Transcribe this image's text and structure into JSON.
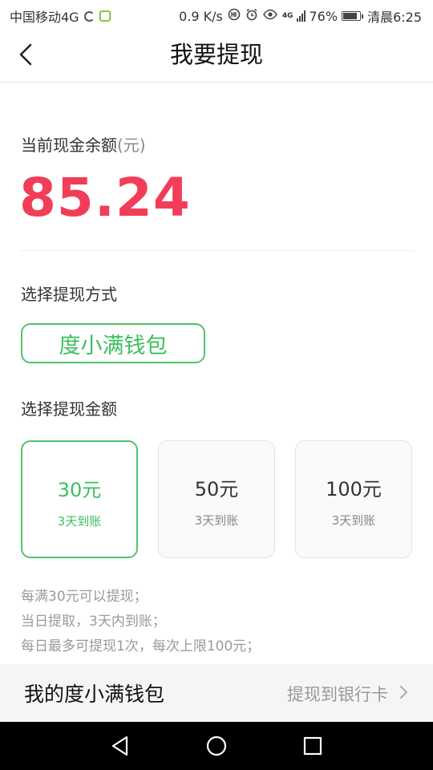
{
  "status_bar": {
    "carrier": "中国移动4G",
    "speed": "0.9 K/s",
    "battery": "76%",
    "time": "清晨6:25",
    "net_tag": "4G"
  },
  "header": {
    "title": "我要提现",
    "back_icon": "chevron-left-icon"
  },
  "balance": {
    "label": "当前现金余额",
    "unit": "(元)",
    "amount": "85.24"
  },
  "method": {
    "label": "选择提现方式",
    "option": "度小满钱包"
  },
  "amount_select": {
    "label": "选择提现金额",
    "options": [
      {
        "value": "30元",
        "sub": "3天到账",
        "selected": true
      },
      {
        "value": "50元",
        "sub": "3天到账",
        "selected": false
      },
      {
        "value": "100元",
        "sub": "3天到账",
        "selected": false
      }
    ]
  },
  "rules": [
    "每满30元可以提现；",
    "当日提取，3天内到账；",
    "每日最多可提现1次，每次上限100元；"
  ],
  "wallet_bar": {
    "title": "我的度小满钱包",
    "link": "提现到银行卡"
  },
  "nav": {
    "back": "triangle-back-icon",
    "home": "circle-home-icon",
    "recents": "square-recents-icon"
  },
  "colors": {
    "accent_green": "#4fc36b",
    "amount_red": "#f23d59"
  }
}
